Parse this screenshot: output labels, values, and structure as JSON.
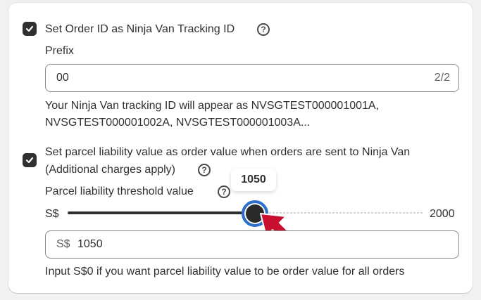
{
  "tracking_option": {
    "checked": true,
    "label": "Set Order ID as Ninja Van Tracking ID",
    "prefix_label": "Prefix",
    "prefix_value": "00",
    "prefix_counter": "2/2",
    "preview_line1": "Your Ninja Van tracking ID will appear as NVSGTEST000001001A,",
    "preview_line2": "NVSGTEST000001002A, NVSGTEST000001003A..."
  },
  "liability_option": {
    "checked": true,
    "label_line1": "Set parcel liability value as order value when orders are sent to Ninja Van",
    "label_line2": "(Additional charges apply)",
    "threshold_label": "Parcel liability threshold value",
    "slider_min_label": "S$",
    "slider_max_label": "2000",
    "slider_value": 1050,
    "slider_max": 2000,
    "tooltip_value": "1050",
    "input_prefix": "S$",
    "input_value": "1050",
    "help_text": "Input S$0 if you want parcel liability value to be order value for all orders"
  },
  "icons": {
    "help": "question-circle-icon",
    "check": "checkmark-icon",
    "annotation": "red-arrow-icon"
  },
  "colors": {
    "checkbox": "#303030",
    "slider_focus": "#2c6ecb",
    "annotation_arrow": "#c8102e"
  }
}
